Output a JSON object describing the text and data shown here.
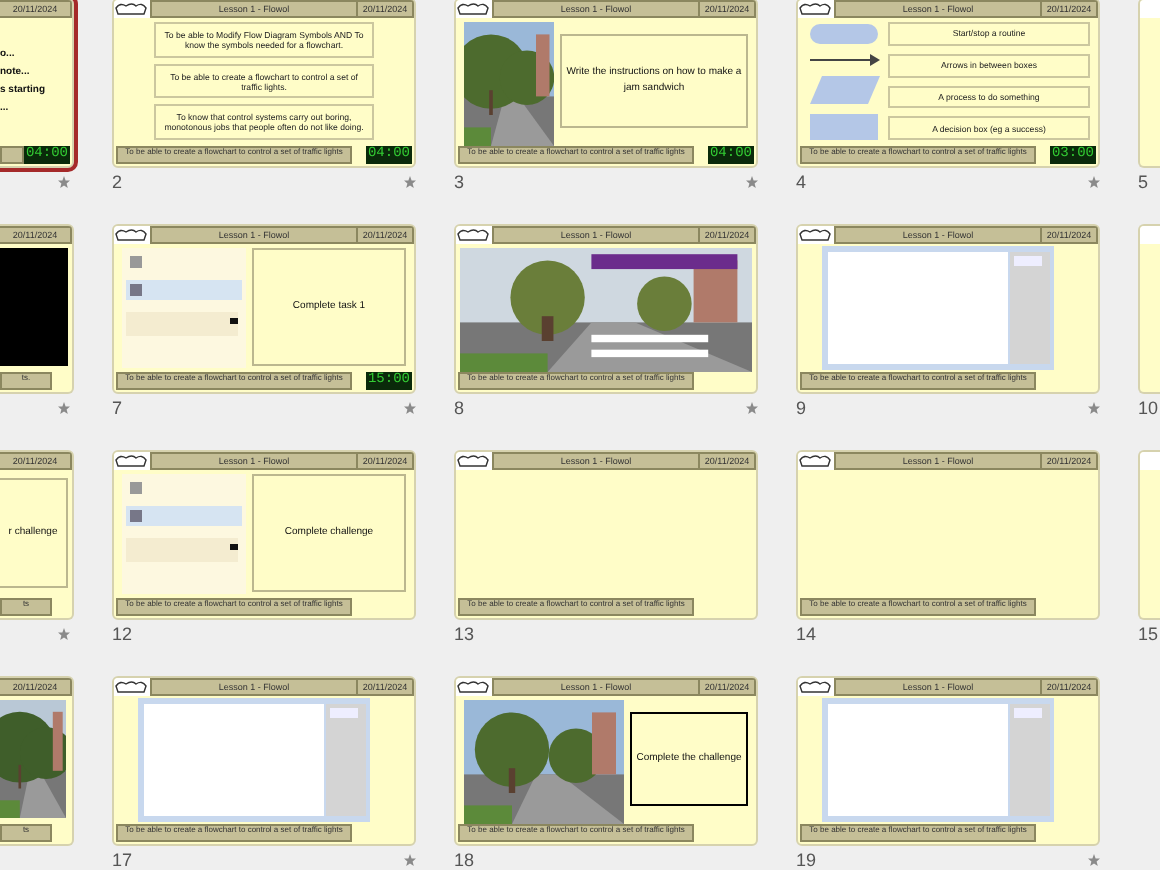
{
  "rows": [
    {
      "cut_left": {
        "selected": true,
        "animated": true,
        "date": "20/11/2024",
        "kind": "text",
        "fragments": [
          "o...",
          "note...",
          "s starting",
          "..."
        ],
        "timer": "04:00"
      },
      "slides": [
        {
          "number": "2",
          "selected": false,
          "animated": true,
          "title": "Lesson 1 - Flowol",
          "date": "20/11/2024",
          "footer": "To be able to create a flowchart to control a set of traffic lights",
          "timer": "04:00",
          "kind": "boxes",
          "texts": [
            "To be able to Modify Flow Diagram Symbols AND To know the symbols needed for a flowchart.",
            "To be able to create a flowchart to control a set of traffic lights.",
            "To know that control systems carry out boring, monotonous jobs that people often do not like doing."
          ]
        },
        {
          "number": "3",
          "selected": false,
          "animated": true,
          "title": "Lesson 1 - Flowol",
          "date": "20/11/2024",
          "footer": "To be able to create a flowchart to control a set of traffic lights",
          "timer": "04:00",
          "kind": "picture_task",
          "texts": [
            "Write the instructions on how to make a jam sandwich"
          ]
        },
        {
          "number": "4",
          "selected": false,
          "animated": true,
          "title": "Lesson 1 - Flowol",
          "date": "20/11/2024",
          "footer": "To be able to create a flowchart to control a set of traffic lights",
          "timer": "03:00",
          "kind": "symbols",
          "texts": [
            "Start/stop a routine",
            "Arrows in between boxes",
            "A process to do something",
            "A decision box (eg a success)"
          ]
        }
      ],
      "cut_right": {
        "number": "5",
        "selected": false
      }
    },
    {
      "cut_left": {
        "selected": false,
        "animated": true,
        "date": "20/11/2024",
        "kind": "black",
        "footer_fragment": "ts."
      },
      "slides": [
        {
          "number": "7",
          "selected": false,
          "animated": true,
          "title": "Lesson 1 - Flowol",
          "date": "20/11/2024",
          "footer": "To be able to create a flowchart to control a set of traffic lights",
          "timer": "15:00",
          "kind": "screenshot_task",
          "texts": [
            "Complete task 1"
          ]
        },
        {
          "number": "8",
          "selected": false,
          "animated": true,
          "title": "Lesson 1 - Flowol",
          "date": "20/11/2024",
          "footer": "To be able to create a flowchart to control a set of traffic lights",
          "kind": "picture"
        },
        {
          "number": "9",
          "selected": false,
          "animated": true,
          "title": "Lesson 1 - Flowol",
          "date": "20/11/2024",
          "footer": "To be able to create a flowchart to control a set of traffic lights",
          "kind": "app_window"
        }
      ],
      "cut_right": {
        "number": "10",
        "selected": false
      }
    },
    {
      "cut_left": {
        "selected": false,
        "animated": true,
        "date": "20/11/2024",
        "kind": "text_box",
        "fragments": [
          "r challenge"
        ],
        "footer_fragment": "ts"
      },
      "slides": [
        {
          "number": "12",
          "selected": false,
          "animated": false,
          "title": "Lesson 1 - Flowol",
          "date": "20/11/2024",
          "footer": "To be able to create a flowchart to control a set of traffic lights",
          "kind": "screenshot_task",
          "texts": [
            "Complete challenge"
          ]
        },
        {
          "number": "13",
          "selected": false,
          "animated": false,
          "title": "Lesson 1 - Flowol",
          "date": "20/11/2024",
          "footer": "To be able to create a flowchart to control a set of traffic lights",
          "kind": "empty"
        },
        {
          "number": "14",
          "selected": false,
          "animated": false,
          "title": "Lesson 1 - Flowol",
          "date": "20/11/2024",
          "footer": "To be able to create a flowchart to control a set of traffic lights",
          "kind": "empty"
        }
      ],
      "cut_right": {
        "number": "15",
        "selected": false
      }
    },
    {
      "cut_left": {
        "selected": false,
        "animated": false,
        "date": "20/11/2024",
        "kind": "picture",
        "footer_fragment": "ts"
      },
      "slides": [
        {
          "number": "17",
          "selected": false,
          "animated": true,
          "title": "Lesson 1 - Flowol",
          "date": "20/11/2024",
          "footer": "To be able to create a flowchart to control a set of traffic lights",
          "kind": "app_window"
        },
        {
          "number": "18",
          "selected": false,
          "animated": false,
          "title": "Lesson 1 - Flowol",
          "date": "20/11/2024",
          "footer": "To be able to create a flowchart to control a set of traffic lights",
          "kind": "picture_task",
          "texts": [
            "Complete the challenge"
          ]
        },
        {
          "number": "19",
          "selected": false,
          "animated": true,
          "title": "Lesson 1 - Flowol",
          "date": "20/11/2024",
          "footer": "To be able to create a flowchart to control a set of traffic lights",
          "kind": "app_window"
        }
      ]
    }
  ]
}
